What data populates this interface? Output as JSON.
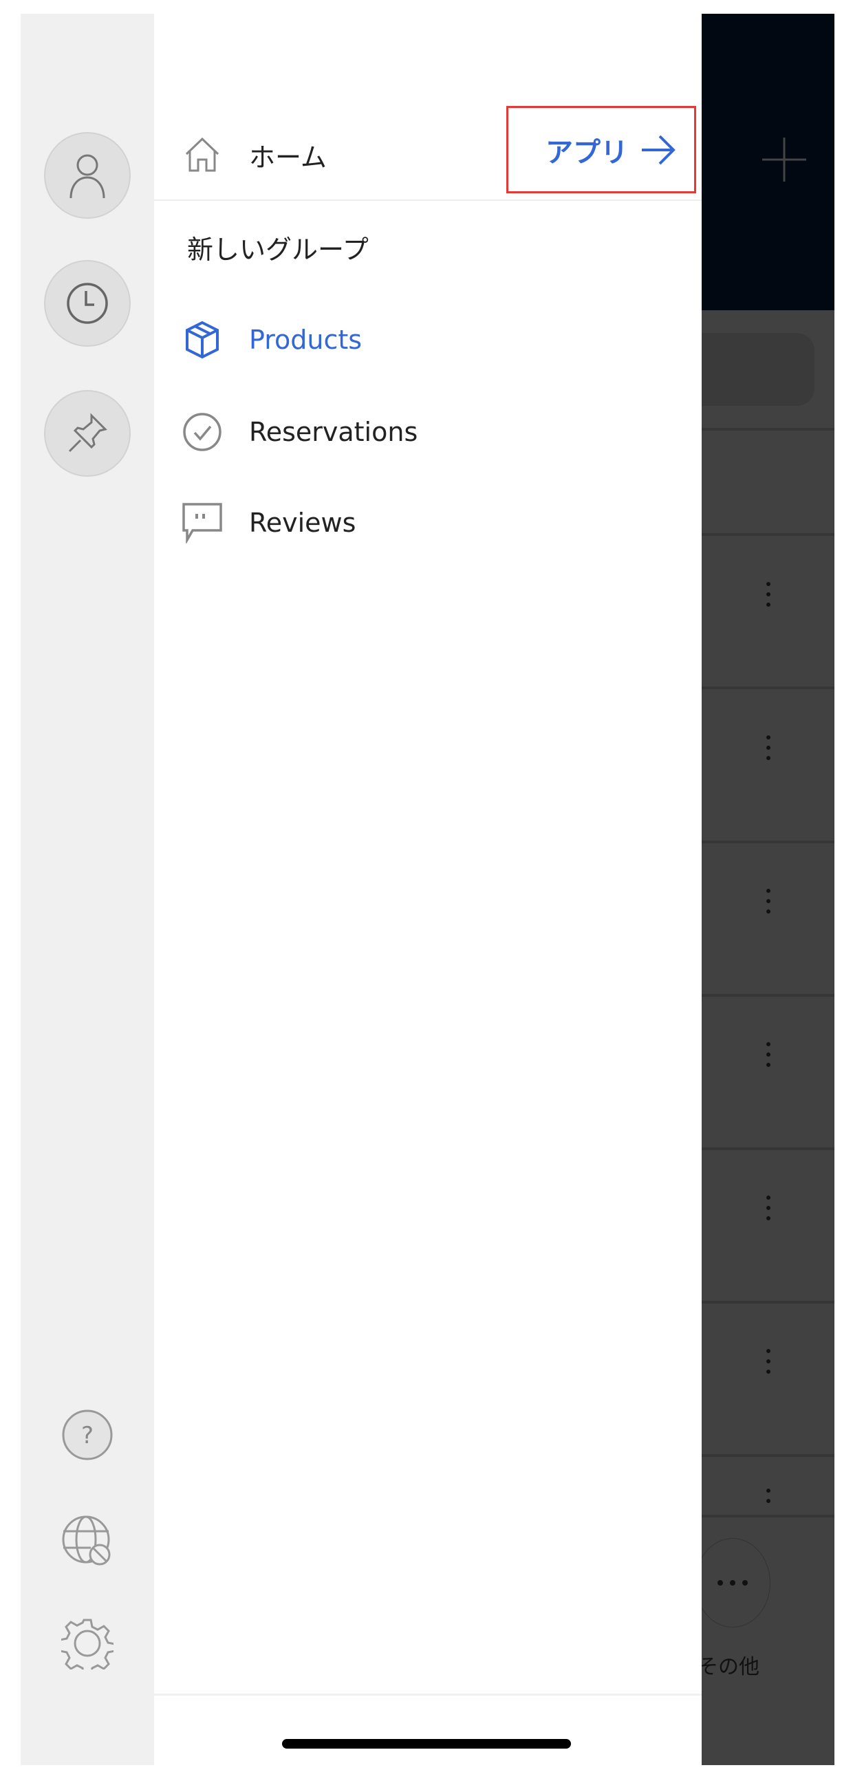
{
  "drawer": {
    "home_label": "ホーム",
    "apps_link_label": "アプリ",
    "group_title": "新しいグループ",
    "items": [
      {
        "label": "Products",
        "icon": "box-icon",
        "active": true
      },
      {
        "label": "Reservations",
        "icon": "check-circle-icon",
        "active": false
      },
      {
        "label": "Reviews",
        "icon": "comment-icon",
        "active": false
      }
    ]
  },
  "background": {
    "more_label": "その他"
  },
  "colors": {
    "accent": "#3367d6",
    "highlight_box": "#e53935",
    "header": "#020812"
  }
}
